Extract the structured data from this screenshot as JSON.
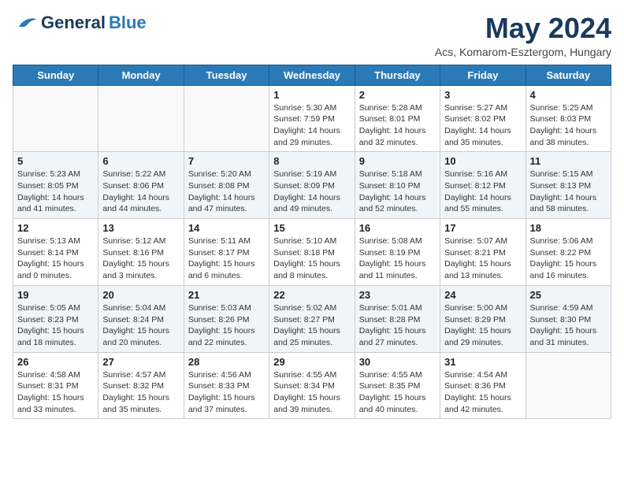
{
  "header": {
    "logo_general": "General",
    "logo_blue": "Blue",
    "title": "May 2024",
    "location": "Acs, Komarom-Esztergom, Hungary"
  },
  "calendar": {
    "days_of_week": [
      "Sunday",
      "Monday",
      "Tuesday",
      "Wednesday",
      "Thursday",
      "Friday",
      "Saturday"
    ],
    "weeks": [
      [
        {
          "day": "",
          "info": ""
        },
        {
          "day": "",
          "info": ""
        },
        {
          "day": "",
          "info": ""
        },
        {
          "day": "1",
          "info": "Sunrise: 5:30 AM\nSunset: 7:59 PM\nDaylight: 14 hours\nand 29 minutes."
        },
        {
          "day": "2",
          "info": "Sunrise: 5:28 AM\nSunset: 8:01 PM\nDaylight: 14 hours\nand 32 minutes."
        },
        {
          "day": "3",
          "info": "Sunrise: 5:27 AM\nSunset: 8:02 PM\nDaylight: 14 hours\nand 35 minutes."
        },
        {
          "day": "4",
          "info": "Sunrise: 5:25 AM\nSunset: 8:03 PM\nDaylight: 14 hours\nand 38 minutes."
        }
      ],
      [
        {
          "day": "5",
          "info": "Sunrise: 5:23 AM\nSunset: 8:05 PM\nDaylight: 14 hours\nand 41 minutes."
        },
        {
          "day": "6",
          "info": "Sunrise: 5:22 AM\nSunset: 8:06 PM\nDaylight: 14 hours\nand 44 minutes."
        },
        {
          "day": "7",
          "info": "Sunrise: 5:20 AM\nSunset: 8:08 PM\nDaylight: 14 hours\nand 47 minutes."
        },
        {
          "day": "8",
          "info": "Sunrise: 5:19 AM\nSunset: 8:09 PM\nDaylight: 14 hours\nand 49 minutes."
        },
        {
          "day": "9",
          "info": "Sunrise: 5:18 AM\nSunset: 8:10 PM\nDaylight: 14 hours\nand 52 minutes."
        },
        {
          "day": "10",
          "info": "Sunrise: 5:16 AM\nSunset: 8:12 PM\nDaylight: 14 hours\nand 55 minutes."
        },
        {
          "day": "11",
          "info": "Sunrise: 5:15 AM\nSunset: 8:13 PM\nDaylight: 14 hours\nand 58 minutes."
        }
      ],
      [
        {
          "day": "12",
          "info": "Sunrise: 5:13 AM\nSunset: 8:14 PM\nDaylight: 15 hours\nand 0 minutes."
        },
        {
          "day": "13",
          "info": "Sunrise: 5:12 AM\nSunset: 8:16 PM\nDaylight: 15 hours\nand 3 minutes."
        },
        {
          "day": "14",
          "info": "Sunrise: 5:11 AM\nSunset: 8:17 PM\nDaylight: 15 hours\nand 6 minutes."
        },
        {
          "day": "15",
          "info": "Sunrise: 5:10 AM\nSunset: 8:18 PM\nDaylight: 15 hours\nand 8 minutes."
        },
        {
          "day": "16",
          "info": "Sunrise: 5:08 AM\nSunset: 8:19 PM\nDaylight: 15 hours\nand 11 minutes."
        },
        {
          "day": "17",
          "info": "Sunrise: 5:07 AM\nSunset: 8:21 PM\nDaylight: 15 hours\nand 13 minutes."
        },
        {
          "day": "18",
          "info": "Sunrise: 5:06 AM\nSunset: 8:22 PM\nDaylight: 15 hours\nand 16 minutes."
        }
      ],
      [
        {
          "day": "19",
          "info": "Sunrise: 5:05 AM\nSunset: 8:23 PM\nDaylight: 15 hours\nand 18 minutes."
        },
        {
          "day": "20",
          "info": "Sunrise: 5:04 AM\nSunset: 8:24 PM\nDaylight: 15 hours\nand 20 minutes."
        },
        {
          "day": "21",
          "info": "Sunrise: 5:03 AM\nSunset: 8:26 PM\nDaylight: 15 hours\nand 22 minutes."
        },
        {
          "day": "22",
          "info": "Sunrise: 5:02 AM\nSunset: 8:27 PM\nDaylight: 15 hours\nand 25 minutes."
        },
        {
          "day": "23",
          "info": "Sunrise: 5:01 AM\nSunset: 8:28 PM\nDaylight: 15 hours\nand 27 minutes."
        },
        {
          "day": "24",
          "info": "Sunrise: 5:00 AM\nSunset: 8:29 PM\nDaylight: 15 hours\nand 29 minutes."
        },
        {
          "day": "25",
          "info": "Sunrise: 4:59 AM\nSunset: 8:30 PM\nDaylight: 15 hours\nand 31 minutes."
        }
      ],
      [
        {
          "day": "26",
          "info": "Sunrise: 4:58 AM\nSunset: 8:31 PM\nDaylight: 15 hours\nand 33 minutes."
        },
        {
          "day": "27",
          "info": "Sunrise: 4:57 AM\nSunset: 8:32 PM\nDaylight: 15 hours\nand 35 minutes."
        },
        {
          "day": "28",
          "info": "Sunrise: 4:56 AM\nSunset: 8:33 PM\nDaylight: 15 hours\nand 37 minutes."
        },
        {
          "day": "29",
          "info": "Sunrise: 4:55 AM\nSunset: 8:34 PM\nDaylight: 15 hours\nand 39 minutes."
        },
        {
          "day": "30",
          "info": "Sunrise: 4:55 AM\nSunset: 8:35 PM\nDaylight: 15 hours\nand 40 minutes."
        },
        {
          "day": "31",
          "info": "Sunrise: 4:54 AM\nSunset: 8:36 PM\nDaylight: 15 hours\nand 42 minutes."
        },
        {
          "day": "",
          "info": ""
        }
      ]
    ]
  }
}
